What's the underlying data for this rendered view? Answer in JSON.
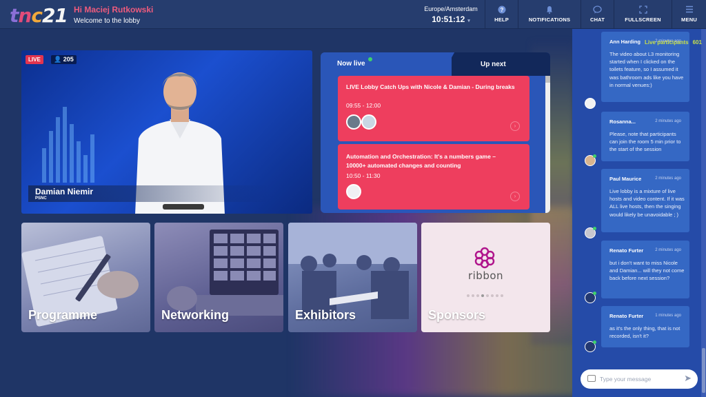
{
  "header": {
    "logo": {
      "t": "t",
      "n": "n",
      "c": "c",
      "num": "21"
    },
    "greeting": "Hi Maciej Rutkowski",
    "subtitle": "Welcome to the lobby",
    "timezone": "Europe/Amsterdam",
    "time": "10:51:12",
    "buttons": {
      "help": "HELP",
      "notifications": "NOTIFICATIONS",
      "chat": "CHAT",
      "fullscreen": "FULLSCREEN",
      "menu": "MENU"
    }
  },
  "video": {
    "live_badge": "LIVE",
    "viewers": "205",
    "speaker_name": "Damian Niemir",
    "speaker_org": "PSNC"
  },
  "schedule": {
    "tabs": {
      "now": "Now live",
      "next": "Up next"
    },
    "sessions": [
      {
        "title": "LIVE Lobby Catch Ups with Nicole & Damian - During breaks",
        "time": "09:55 - 12:00"
      },
      {
        "title": "Automation and Orchestration: It's a numbers game – 10000+ automated changes and counting",
        "time": "10:50 - 11:30"
      }
    ]
  },
  "tiles": {
    "programme": "Programme",
    "networking": "Networking",
    "exhibitors": "Exhibitors",
    "sponsors": "Sponsors",
    "sponsor_logo_text": "ribbon"
  },
  "chat": {
    "participants_label": "Live participants",
    "participants_count": "601",
    "messages": [
      {
        "author": "Ann Harding",
        "time": "2 minutes ago",
        "text": "The video about L3 monitoring started when I clicked on the toilets feature, so I assumed it was bathroom ads like you have in normal venues:)"
      },
      {
        "author": "Rosanna...",
        "time": "2 minutes ago",
        "text": "Please, note that participants can join the room 5 min prior to the start of the session"
      },
      {
        "author": "Paul Maurice",
        "time": "2 minutes ago",
        "text": "Live lobby is a mixture of live hosts and video content. If it was ALL live hosts, then the singing would likely be unavoidable ; )"
      },
      {
        "author": "Renato Furter",
        "time": "2 minutes ago",
        "text": "but i don't want to miss Nicole and Damian... will they not come back before next session?"
      },
      {
        "author": "Renato Furter",
        "time": "1 minutes ago",
        "text": "as it's the only thing, that is not recorded, isn't it?"
      }
    ],
    "input_placeholder": "Type your message"
  }
}
